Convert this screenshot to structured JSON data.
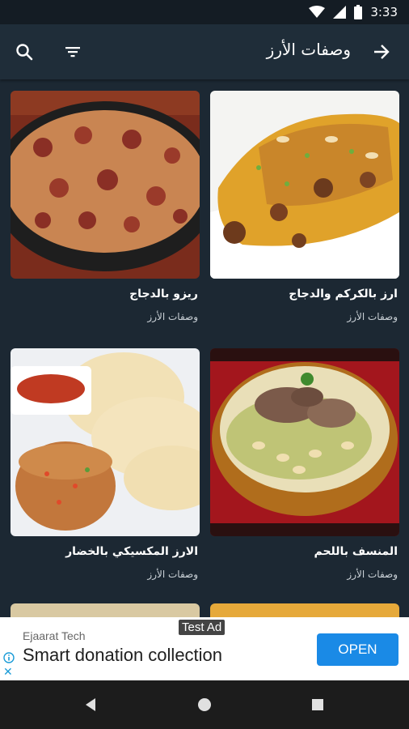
{
  "status_bar": {
    "time": "3:33",
    "icons": [
      "wifi-icon",
      "cellular-signal-icon",
      "battery-icon"
    ]
  },
  "app_bar": {
    "title": "وصفات الأرز",
    "back_icon": "arrow-right-icon",
    "filter_icon": "filter-icon",
    "search_icon": "search-icon"
  },
  "recipes": [
    {
      "title": "ارز بالكركم والدجاج",
      "category": "وصفات الأرز",
      "image": "turmeric-rice-chicken-photo"
    },
    {
      "title": "ريزو بالدجاج",
      "category": "وصفات الأرز",
      "image": "chicken-risotto-photo"
    },
    {
      "title": "المنسف باللحم",
      "category": "وصفات الأرز",
      "image": "mansaf-meat-photo"
    },
    {
      "title": "الارز المكسيكي بالخضار",
      "category": "وصفات الأرز",
      "image": "mexican-rice-vegetables-photo"
    }
  ],
  "ad": {
    "badge": "Test Ad",
    "advertiser": "Ejaarat Tech",
    "headline": "Smart donation collection",
    "cta": "OPEN",
    "close_label": "✕"
  },
  "colors": {
    "background": "#1c2833",
    "app_bar": "#1f2d39",
    "ad_button": "#1a8ae6"
  }
}
